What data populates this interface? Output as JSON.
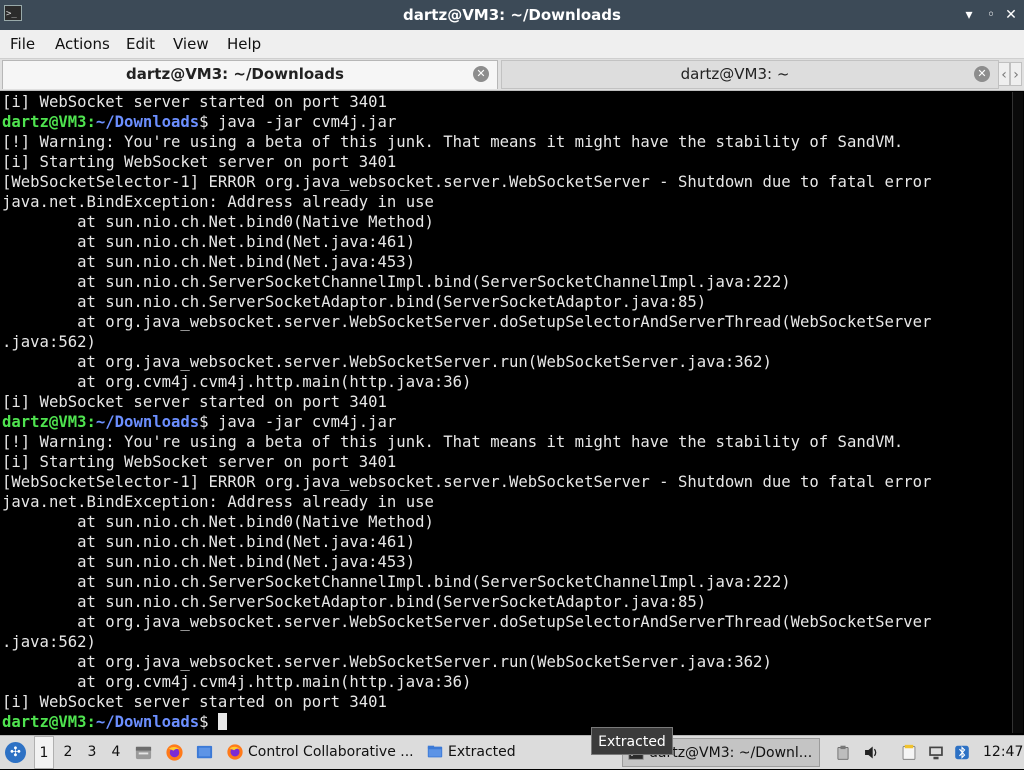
{
  "window": {
    "title": "dartz@VM3: ~/Downloads",
    "minimize_glyph": "▾",
    "maximize_glyph": "◦",
    "close_glyph": "✕"
  },
  "menu": [
    "File",
    "Actions",
    "Edit",
    "View",
    "Help"
  ],
  "tabs": [
    {
      "label": "dartz@VM3: ~/Downloads",
      "active": true
    },
    {
      "label": "dartz@VM3: ~",
      "active": false
    }
  ],
  "prompt": {
    "user": "dartz@VM3",
    "path": "~/Downloads",
    "symbol": "$"
  },
  "terminal_lines": [
    {
      "type": "text",
      "text": "[i] WebSocket server started on port 3401"
    },
    {
      "type": "prompt",
      "cmd": " java -jar cvm4j.jar"
    },
    {
      "type": "text",
      "text": "[!] Warning: You're using a beta of this junk. That means it might have the stability of SandVM."
    },
    {
      "type": "text",
      "text": "[i] Starting WebSocket server on port 3401"
    },
    {
      "type": "text",
      "text": "[WebSocketSelector-1] ERROR org.java_websocket.server.WebSocketServer - Shutdown due to fatal error"
    },
    {
      "type": "text",
      "text": "java.net.BindException: Address already in use"
    },
    {
      "type": "text",
      "text": "        at sun.nio.ch.Net.bind0(Native Method)"
    },
    {
      "type": "text",
      "text": "        at sun.nio.ch.Net.bind(Net.java:461)"
    },
    {
      "type": "text",
      "text": "        at sun.nio.ch.Net.bind(Net.java:453)"
    },
    {
      "type": "text",
      "text": "        at sun.nio.ch.ServerSocketChannelImpl.bind(ServerSocketChannelImpl.java:222)"
    },
    {
      "type": "text",
      "text": "        at sun.nio.ch.ServerSocketAdaptor.bind(ServerSocketAdaptor.java:85)"
    },
    {
      "type": "text",
      "text": "        at org.java_websocket.server.WebSocketServer.doSetupSelectorAndServerThread(WebSocketServer"
    },
    {
      "type": "text",
      "text": ".java:562)"
    },
    {
      "type": "text",
      "text": "        at org.java_websocket.server.WebSocketServer.run(WebSocketServer.java:362)"
    },
    {
      "type": "text",
      "text": "        at org.cvm4j.cvm4j.http.main(http.java:36)"
    },
    {
      "type": "text",
      "text": "[i] WebSocket server started on port 3401"
    },
    {
      "type": "prompt",
      "cmd": " java -jar cvm4j.jar"
    },
    {
      "type": "text",
      "text": "[!] Warning: You're using a beta of this junk. That means it might have the stability of SandVM."
    },
    {
      "type": "text",
      "text": "[i] Starting WebSocket server on port 3401"
    },
    {
      "type": "text",
      "text": "[WebSocketSelector-1] ERROR org.java_websocket.server.WebSocketServer - Shutdown due to fatal error"
    },
    {
      "type": "text",
      "text": "java.net.BindException: Address already in use"
    },
    {
      "type": "text",
      "text": "        at sun.nio.ch.Net.bind0(Native Method)"
    },
    {
      "type": "text",
      "text": "        at sun.nio.ch.Net.bind(Net.java:461)"
    },
    {
      "type": "text",
      "text": "        at sun.nio.ch.Net.bind(Net.java:453)"
    },
    {
      "type": "text",
      "text": "        at sun.nio.ch.ServerSocketChannelImpl.bind(ServerSocketChannelImpl.java:222)"
    },
    {
      "type": "text",
      "text": "        at sun.nio.ch.ServerSocketAdaptor.bind(ServerSocketAdaptor.java:85)"
    },
    {
      "type": "text",
      "text": "        at org.java_websocket.server.WebSocketServer.doSetupSelectorAndServerThread(WebSocketServer"
    },
    {
      "type": "text",
      "text": ".java:562)"
    },
    {
      "type": "text",
      "text": "        at org.java_websocket.server.WebSocketServer.run(WebSocketServer.java:362)"
    },
    {
      "type": "text",
      "text": "        at org.cvm4j.cvm4j.http.main(http.java:36)"
    },
    {
      "type": "text",
      "text": "[i] WebSocket server started on port 3401"
    },
    {
      "type": "prompt",
      "cmd": " ",
      "cursor": true
    }
  ],
  "taskbar": {
    "workspaces": [
      "1",
      "2",
      "3",
      "4"
    ],
    "tasks": [
      {
        "label": "Control Collaborative ...",
        "icon": "firefox-icon"
      },
      {
        "label": "Extracted",
        "icon": "folder-icon"
      },
      {
        "label": "dartz@VM3: ~/Downl...",
        "icon": "terminal-icon"
      }
    ],
    "tooltip": "Extracted",
    "clock": "12:47"
  },
  "colors": {
    "prompt_user": "#4fe34f",
    "prompt_path": "#6c8fff",
    "terminal_bg": "#000000",
    "titlebar_bg": "#3c4a57"
  }
}
